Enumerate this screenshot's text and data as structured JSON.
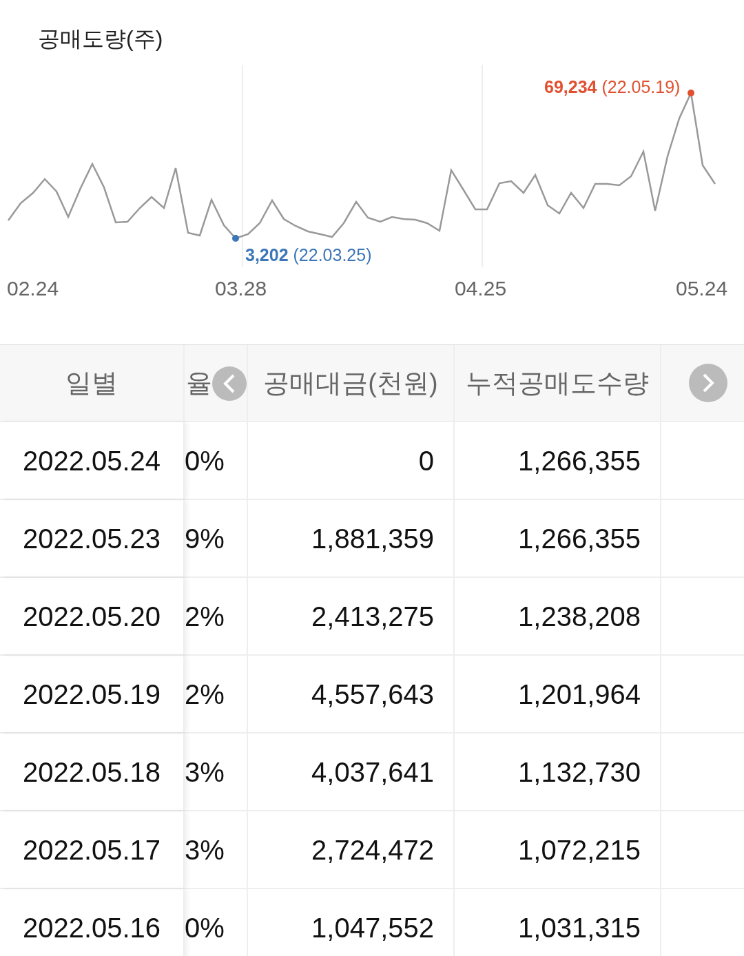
{
  "chart": {
    "title": "공매도량(주)",
    "max_label": {
      "value": "69,234",
      "date": "(22.05.19)"
    },
    "min_label": {
      "value": "3,202",
      "date": "(22.03.25)"
    },
    "x_labels": [
      "02.24",
      "03.28",
      "04.25",
      "05.24"
    ]
  },
  "table": {
    "columns": [
      {
        "label": "일별"
      },
      {
        "label": "율"
      },
      {
        "label": "공매대금(천원)"
      },
      {
        "label": "누적공매도수량"
      }
    ],
    "rows": [
      [
        "2022.05.24",
        "0%",
        "0",
        "1,266,355"
      ],
      [
        "2022.05.23",
        "9%",
        "1,881,359",
        "1,266,355"
      ],
      [
        "2022.05.20",
        "2%",
        "2,413,275",
        "1,238,208"
      ],
      [
        "2022.05.19",
        "2%",
        "4,557,643",
        "1,201,964"
      ],
      [
        "2022.05.18",
        "3%",
        "4,037,641",
        "1,132,730"
      ],
      [
        "2022.05.17",
        "3%",
        "2,724,472",
        "1,072,215"
      ],
      [
        "2022.05.16",
        "0%",
        "1,047,552",
        "1,031,315"
      ]
    ]
  }
}
